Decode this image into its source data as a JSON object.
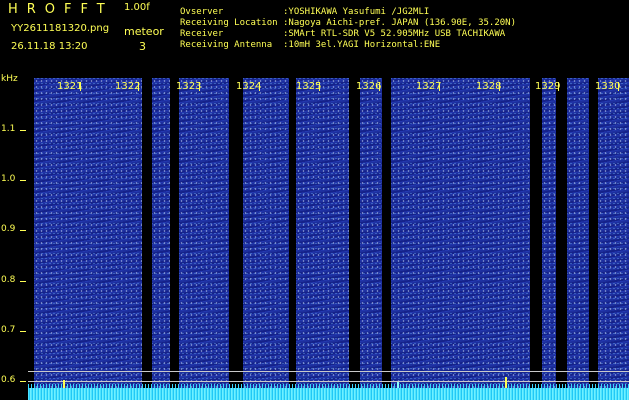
{
  "header": {
    "app_title": "HROFFT",
    "version": "1.00f",
    "filename": "YY2611181320.png",
    "meteor_label": "meteor",
    "datetime": "26.11.18 13:20",
    "meteor_count": "3"
  },
  "info": [
    {
      "key": "Ovserver",
      "value": ":YOSHIKAWA Yasufumi /JG2MLI"
    },
    {
      "key": "Receiving Location",
      "value": ":Nagoya Aichi-pref. JAPAN (136.90E, 35.20N)"
    },
    {
      "key": "Receiver",
      "value": ":SMArt RTL-SDR V5 52.905MHz USB TACHIKAWA"
    },
    {
      "key": "Receiving Antenna",
      "value": ":10mH 3el.YAGI Horizontal:ENE"
    }
  ],
  "axis": {
    "unit": "kHz",
    "y_ticks": [
      "1.1",
      "1.0",
      "0.9",
      "0.8",
      "0.7",
      "0.6"
    ],
    "x_labels": [
      "1321",
      "1322",
      "1323",
      "1324",
      "1325",
      "1326",
      "1327",
      "1328",
      "1329",
      "1330"
    ]
  },
  "colors": {
    "label": "#ffff55",
    "band": "#1d2f9e",
    "floor": "#4fe3ff"
  }
}
